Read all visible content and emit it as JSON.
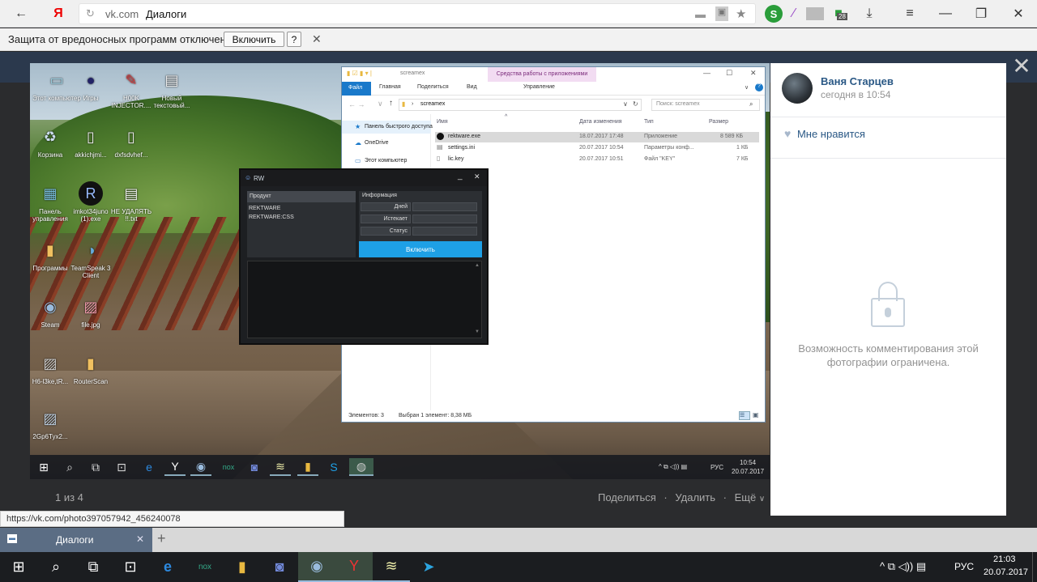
{
  "browser": {
    "url_host": "vk.com",
    "page_title": "Диалоги",
    "ext_badge": "28",
    "infobar_text": "Защита от вредоносных программ отключена",
    "infobar_enable": "Включить",
    "infobar_help": "?",
    "status_url": "https://vk.com/photo397057942_456240078",
    "tab_title": "Диалоги"
  },
  "desktop_icons": [
    {
      "label": "Этот компьютер",
      "icon": "computer-icon"
    },
    {
      "label": "Игры",
      "icon": "games-icon"
    },
    {
      "label": "H00K INJECTOR....",
      "icon": "injector-icon"
    },
    {
      "label": "Новый текстовый...",
      "icon": "text-file-icon"
    },
    {
      "label": "Корзина",
      "icon": "recycle-bin-icon"
    },
    {
      "label": "akkichjmi...",
      "icon": "file-icon"
    },
    {
      "label": "dxfsdvhef...",
      "icon": "file-icon"
    },
    {
      "label": "Панель управления",
      "icon": "control-panel-icon"
    },
    {
      "label": "imkot34juno (1).exe",
      "icon": "rw-icon"
    },
    {
      "label": "НЕ УДАЛЯТЬ !!.txt",
      "icon": "text-file-icon"
    },
    {
      "label": "Программы",
      "icon": "folder-icon"
    },
    {
      "label": "TeamSpeak 3 Client",
      "icon": "teamspeak-icon"
    },
    {
      "label": "Steam",
      "icon": "steam-icon"
    },
    {
      "label": "file.jpg",
      "icon": "image-icon"
    },
    {
      "label": "H6-l3ke,tR...",
      "icon": "image-icon"
    },
    {
      "label": "RouterScan",
      "icon": "folder-icon"
    },
    {
      "label": "2Gp6Tyx2...",
      "icon": "image-icon"
    }
  ],
  "explorer": {
    "title": "screamex",
    "ribbon_context": "Средства работы с приложениями",
    "tabs": [
      "Файл",
      "Главная",
      "Поделиться",
      "Вид",
      "Управление"
    ],
    "path": "screamex",
    "search_placeholder": "Поиск: screamex",
    "nav": [
      "Панель быстрого доступа",
      "OneDrive",
      "Этот компьютер"
    ],
    "columns": [
      "Имя",
      "Дата изменения",
      "Тип",
      "Размер"
    ],
    "rows": [
      {
        "name": "rektware.exe",
        "date": "18.07.2017 17:48",
        "type": "Приложение",
        "size": "8 589 КБ"
      },
      {
        "name": "settings.ini",
        "date": "20.07.2017 10:54",
        "type": "Параметры конф...",
        "size": "1 КБ"
      },
      {
        "name": "lic.key",
        "date": "20.07.2017 10:51",
        "type": "Файл \"KEY\"",
        "size": "7 КБ"
      }
    ],
    "status_count": "Элементов: 3",
    "status_selected": "Выбран 1 элемент: 8,38 МБ"
  },
  "rw": {
    "title": "RW",
    "product_header": "Продукт",
    "products": [
      "REKTWARE",
      "REKTWARE:CSS"
    ],
    "info_header": "Информация",
    "fields": [
      "Дней",
      "Истекает",
      "Статус"
    ],
    "button": "Включить"
  },
  "inner_tray": {
    "lang": "РУС",
    "time": "10:54",
    "date": "20.07.2017"
  },
  "viewer": {
    "counter": "1 из 4",
    "share": "Поделиться",
    "delete": "Удалить",
    "more": "Ещё"
  },
  "side": {
    "name": "Ваня Старцев",
    "time": "сегодня в 10:54",
    "like": "Мне нравится",
    "comment_locked": "Возможность комментирования этой фотографии ограничена."
  },
  "tray": {
    "lang": "РУС",
    "time": "21:03",
    "date": "20.07.2017"
  }
}
